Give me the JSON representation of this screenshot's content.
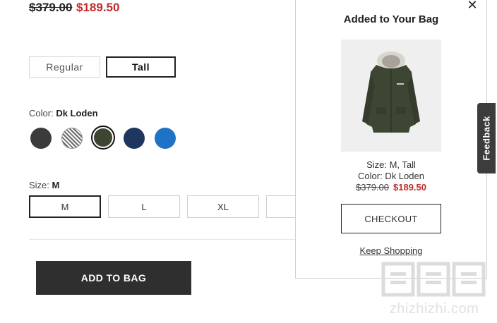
{
  "product": {
    "price_original": "$379.00",
    "price_sale": "$189.50"
  },
  "fit": {
    "options": [
      "Regular",
      "Tall"
    ],
    "selected": "Tall"
  },
  "color": {
    "label": "Color:",
    "selected_name": "Dk Loden",
    "swatches": [
      {
        "name": "charcoal",
        "hex": "#3b3b3b"
      },
      {
        "name": "heather",
        "hex": "#bdbdbd"
      },
      {
        "name": "dk-loden",
        "hex": "#3d4632"
      },
      {
        "name": "navy",
        "hex": "#1f3660"
      },
      {
        "name": "blue",
        "hex": "#1e73c6"
      }
    ],
    "selected_index": 2
  },
  "size": {
    "label": "Size:",
    "selected": "M",
    "options": [
      "M",
      "L",
      "XL"
    ]
  },
  "add_to_bag_label": "ADD TO BAG",
  "bag_panel": {
    "title": "Added to Your Bag",
    "size_line": "Size: M, Tall",
    "color_line": "Color: Dk Loden",
    "price_original": "$379.00",
    "price_sale": "$189.50",
    "checkout_label": "CHECKOUT",
    "keep_shopping_label": "Keep Shopping",
    "close_icon": "close-icon"
  },
  "feedback_label": "Feedback",
  "watermark": {
    "chars": "值值值",
    "text": "zhizhizhi.com"
  },
  "colors": {
    "sale_red": "#c12d2d",
    "dark_button": "#2f2f2f",
    "feedback_tab": "#3c3c3c"
  }
}
